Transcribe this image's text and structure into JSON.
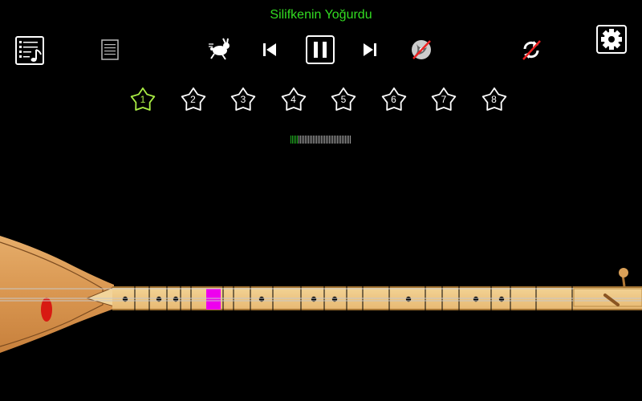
{
  "song": {
    "title": "Silifkenin Yoğurdu"
  },
  "toolbar": {
    "left": [
      {
        "name": "playlist-icon"
      },
      {
        "name": "notes-document-icon"
      }
    ],
    "center": [
      {
        "name": "tempo-rabbit-icon"
      },
      {
        "name": "previous-track-icon"
      },
      {
        "name": "pause-icon"
      },
      {
        "name": "next-track-icon"
      },
      {
        "name": "metronome-off-icon"
      }
    ],
    "right": [
      {
        "name": "repeat-off-icon"
      },
      {
        "name": "settings-gear-icon"
      }
    ]
  },
  "stars": {
    "labels": [
      "1",
      "2",
      "3",
      "4",
      "5",
      "6",
      "7",
      "8"
    ],
    "active_index": 0,
    "active_color": "#aaee44",
    "inactive_color": "#ffffff"
  },
  "playback": {
    "progress_fraction": 0.12,
    "played_color": "#22aa22"
  },
  "instrument": {
    "name": "bağlama",
    "highlight_color": "#ee00ee",
    "highlighted_fret_index": 6
  },
  "colors": {
    "title": "#33dd22",
    "background": "#000000"
  }
}
